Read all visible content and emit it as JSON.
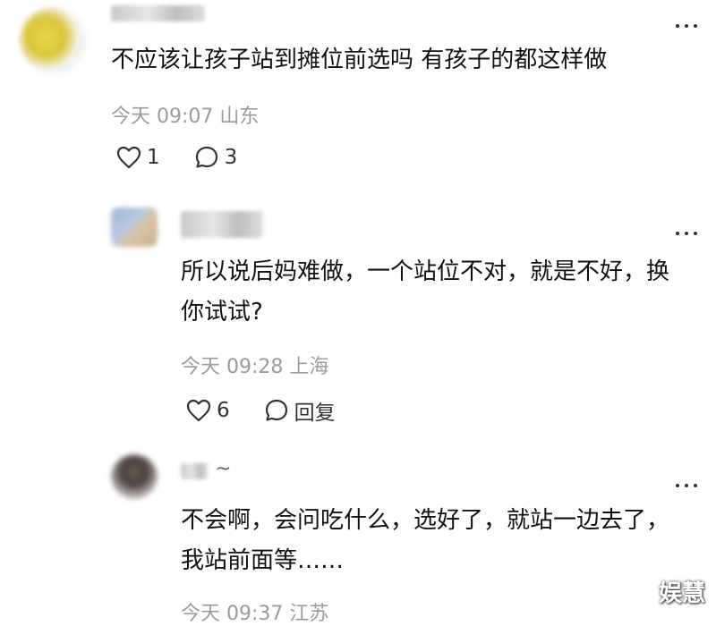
{
  "comments": [
    {
      "text": "不应该让孩子站到摊位前选吗 有孩子的都这样做",
      "time": "今天 09:07",
      "location": "山东",
      "likes": "1",
      "replies": "3"
    },
    {
      "text": "所以说后妈难做，一个站位不对，就是不好，换你试试?",
      "time": "今天 09:28",
      "location": "上海",
      "likes": "6",
      "reply_label": "回复"
    },
    {
      "text": "不会啊，会问吃什么，选好了，就站一边去了，我站前面等……",
      "time": "今天 09:37",
      "location": "江苏",
      "name_suffix": "~"
    }
  ],
  "watermark": "娱慧",
  "icons": [
    "heart-icon",
    "comment-icon",
    "more-icon"
  ]
}
